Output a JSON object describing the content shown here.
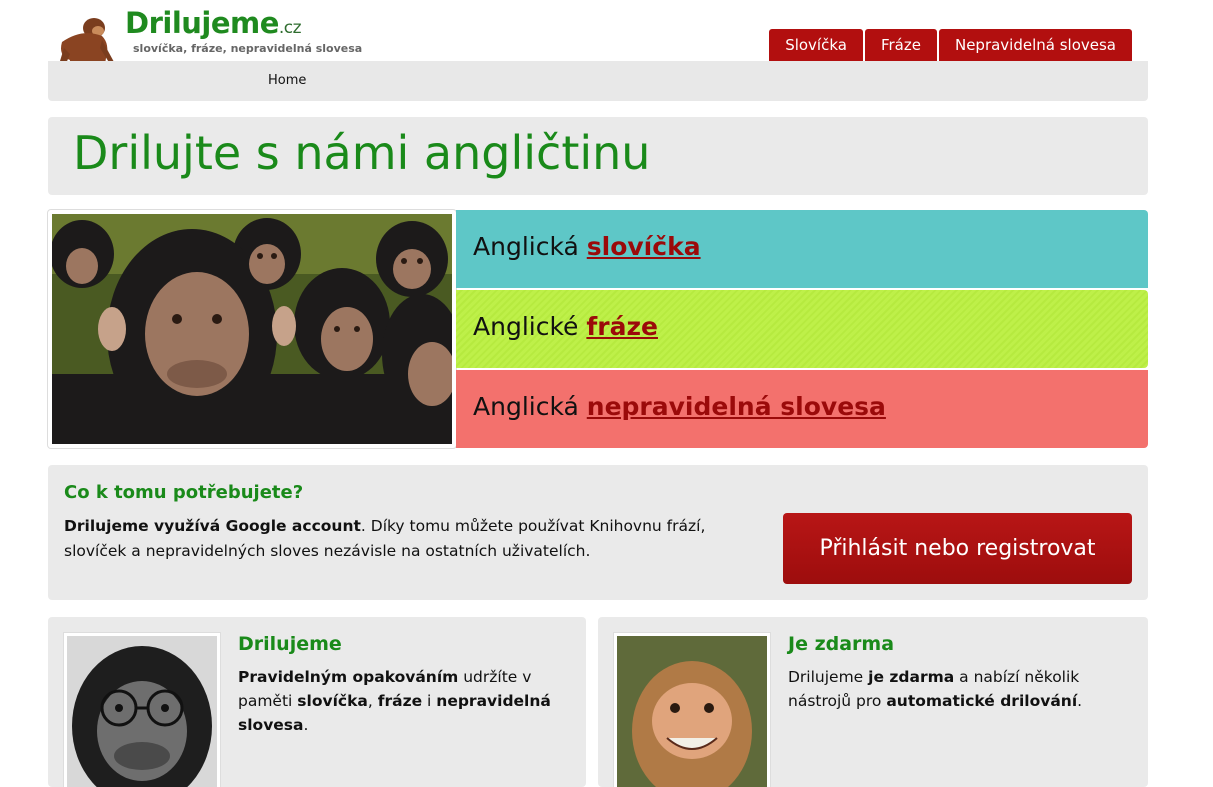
{
  "logo": {
    "title": "Drilujeme",
    "tld": ".cz",
    "tagline": "slovíčka, fráze, nepravidelná slovesa"
  },
  "nav": {
    "tabs": [
      {
        "label": "Slovíčka"
      },
      {
        "label": "Fráze"
      },
      {
        "label": "Nepravidelná slovesa"
      }
    ],
    "breadcrumb": "Home"
  },
  "hero": {
    "title": "Drilujte s námi angličtinu"
  },
  "categories": [
    {
      "prefix": "Anglická",
      "link": "slovíčka",
      "color": "#5ec7c7"
    },
    {
      "prefix": "Anglické",
      "link": "fráze",
      "color": "#bef049"
    },
    {
      "prefix": "Anglická",
      "link": "nepravidelná slovesa",
      "color": "#f3716d"
    }
  ],
  "login": {
    "heading": "Co k tomu potřebujete?",
    "text_bold": "Drilujeme využívá Google account",
    "text_rest": ". Díky tomu můžete používat Knihovnu frází, slovíček a nepravidelných sloves nezávisle na ostatních uživatelích.",
    "button": "Přihlásit nebo registrovat"
  },
  "cards": [
    {
      "title": "Drilujeme",
      "parts": [
        "Pravidelným opakováním",
        " udržíte v paměti ",
        "slovíčka",
        ", ",
        "fráze",
        " i ",
        "nepravidelná slovesa",
        "."
      ]
    },
    {
      "title": "Je zdarma",
      "parts": [
        "Drilujeme ",
        "je zdarma",
        " a nabízí několik nástrojů pro ",
        "automatické drilování",
        "."
      ]
    }
  ],
  "colors": {
    "brand_green": "#1a8a1a",
    "brand_red": "#b20f0f"
  }
}
